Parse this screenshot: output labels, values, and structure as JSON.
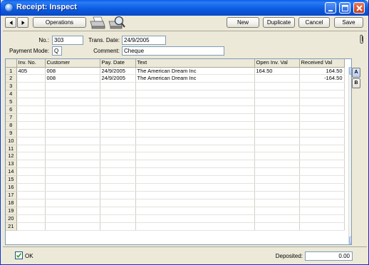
{
  "window": {
    "title": "Receipt: Inspect",
    "controls": [
      "minimize-icon",
      "maximize-icon",
      "close-icon"
    ]
  },
  "toolbar": {
    "operations_label": "Operations",
    "new_label": "New",
    "duplicate_label": "Duplicate",
    "cancel_label": "Cancel",
    "save_label": "Save",
    "icons": [
      "nav-prev-icon",
      "nav-next-icon",
      "printer-icon",
      "print-preview-icon",
      "paperclip-icon"
    ]
  },
  "header": {
    "no_label": "No.:",
    "no_value": "303",
    "trans_date_label": "Trans. Date:",
    "trans_date_value": "24/9/2005",
    "payment_mode_label": "Payment Mode:",
    "payment_mode_value": "Q",
    "comment_label": "Comment:",
    "comment_value": "Cheque"
  },
  "matrix": {
    "columns": [
      "Inv. No.",
      "Customer",
      "Pay. Date",
      "Text",
      "Open Inv. Val",
      "Received Val"
    ],
    "rows": [
      {
        "n": "1",
        "inv": "405",
        "customer": "008",
        "pay_date": "24/9/2005",
        "text": "The American Dream Inc",
        "open": "164.50",
        "received": "164.50"
      },
      {
        "n": "2",
        "inv": "",
        "customer": "008",
        "pay_date": "24/9/2005",
        "text": "The American Dream Inc",
        "open": "",
        "received": "-164.50"
      },
      {
        "n": "3"
      },
      {
        "n": "4"
      },
      {
        "n": "5"
      },
      {
        "n": "6"
      },
      {
        "n": "7"
      },
      {
        "n": "8"
      },
      {
        "n": "9"
      },
      {
        "n": "10"
      },
      {
        "n": "11"
      },
      {
        "n": "12"
      },
      {
        "n": "13"
      },
      {
        "n": "14"
      },
      {
        "n": "15"
      },
      {
        "n": "16"
      },
      {
        "n": "17"
      },
      {
        "n": "18"
      },
      {
        "n": "19"
      },
      {
        "n": "20"
      },
      {
        "n": "21"
      }
    ],
    "side_tabs": [
      "A",
      "B"
    ]
  },
  "footer": {
    "ok_label": "OK",
    "ok_checked": true,
    "deposited_label": "Deposited:",
    "deposited_value": "0.00"
  }
}
